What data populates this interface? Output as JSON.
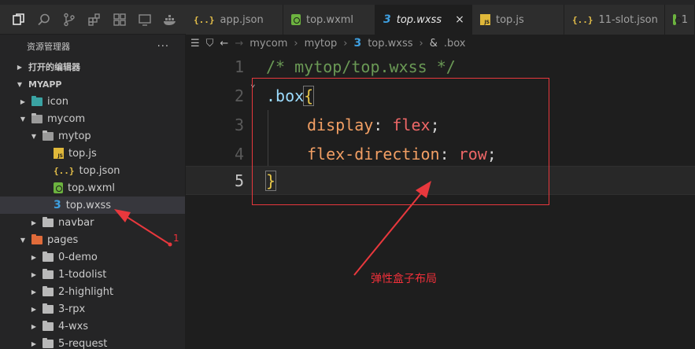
{
  "tabs": [
    {
      "label": "app.json",
      "icon": "json-icon",
      "active": false
    },
    {
      "label": "top.wxml",
      "icon": "wxml-icon",
      "active": false
    },
    {
      "label": "top.wxss",
      "icon": "css-icon",
      "active": true
    },
    {
      "label": "top.js",
      "icon": "js-icon",
      "active": false
    },
    {
      "label": "11-slot.json",
      "icon": "json-icon",
      "active": false
    },
    {
      "label": "1",
      "icon": "wxml-icon",
      "active": false
    }
  ],
  "tab_close_glyph": "×",
  "sidebar": {
    "title": "资源管理器",
    "more": "···",
    "open_editors": "打开的编辑器",
    "project": "MYAPP",
    "tree": [
      {
        "label": "icon",
        "depth": 1,
        "type": "folder-teal",
        "expanded": false
      },
      {
        "label": "mycom",
        "depth": 1,
        "type": "folder",
        "expanded": true
      },
      {
        "label": "mytop",
        "depth": 2,
        "type": "folder",
        "expanded": true
      },
      {
        "label": "top.js",
        "depth": 3,
        "type": "js"
      },
      {
        "label": "top.json",
        "depth": 3,
        "type": "json"
      },
      {
        "label": "top.wxml",
        "depth": 3,
        "type": "wxml"
      },
      {
        "label": "top.wxss",
        "depth": 3,
        "type": "css",
        "selected": true
      },
      {
        "label": "navbar",
        "depth": 2,
        "type": "folder",
        "expanded": false
      },
      {
        "label": "pages",
        "depth": 1,
        "type": "folder-pages",
        "expanded": true
      },
      {
        "label": "0-demo",
        "depth": 2,
        "type": "folder",
        "expanded": false
      },
      {
        "label": "1-todolist",
        "depth": 2,
        "type": "folder",
        "expanded": false
      },
      {
        "label": "2-highlight",
        "depth": 2,
        "type": "folder",
        "expanded": false
      },
      {
        "label": "3-rpx",
        "depth": 2,
        "type": "folder",
        "expanded": false
      },
      {
        "label": "4-wxs",
        "depth": 2,
        "type": "folder",
        "expanded": false
      },
      {
        "label": "5-request",
        "depth": 2,
        "type": "folder",
        "expanded": false
      }
    ]
  },
  "breadcrumb": [
    "mycom",
    "mytop",
    "top.wxss",
    ".box"
  ],
  "editor": {
    "lines": [
      {
        "num": "1",
        "comment": "/* mytop/top.wxss */"
      },
      {
        "num": "2",
        "selector": ".box",
        "brace": "{"
      },
      {
        "num": "3",
        "prop": "display",
        "colon": ": ",
        "value": "flex",
        "semi": ";"
      },
      {
        "num": "4",
        "prop": "flex-direction",
        "colon": ": ",
        "value": "row",
        "semi": ";"
      },
      {
        "num": "5",
        "brace": "}"
      }
    ],
    "current_line": 5
  },
  "annotations": {
    "label": "弹性盒子布局",
    "number": "1"
  },
  "colors": {
    "annotation": "#e8383d",
    "comment": "#6a9955",
    "selector": "#9cdcfe",
    "property": "#f29f64",
    "value": "#ee6767",
    "brace": "#e8c84a"
  }
}
